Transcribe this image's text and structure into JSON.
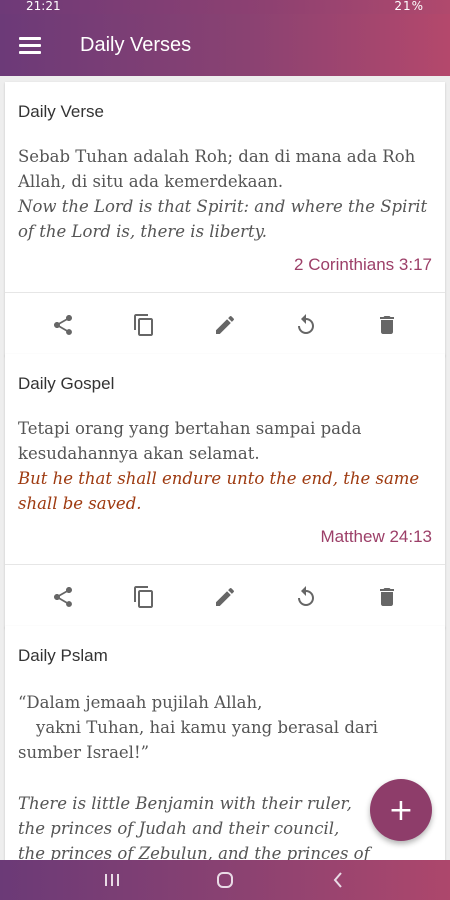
{
  "status": {
    "time": "21:21",
    "right": "21%"
  },
  "app_bar": {
    "title": "Daily Verses"
  },
  "cards": [
    {
      "title": "Daily Verse",
      "text_id": "Sebab Tuhan adalah Roh; dan di mana ada Roh Allah, di situ ada kemerdekaan.",
      "text_en": "Now the Lord is that Spirit: and where the Spirit of the Lord is, there is liberty.",
      "reference": "2 Corinthians 3:17"
    },
    {
      "title": "Daily Gospel",
      "text_id": "Tetapi orang yang bertahan sampai pada kesudahannya akan selamat.",
      "text_en": "But he that shall endure unto the end, the same shall be saved.",
      "reference": "Matthew 24:13"
    },
    {
      "title": "Daily Pslam",
      "text_id_line1": "“Dalam jemaah pujilah Allah,",
      "text_id_line2": "yakni Tuhan, hai kamu yang berasal dari",
      "text_id_line3": "sumber Israel!”",
      "text_en_line1": "There is little Benjamin with their ruler,",
      "text_en_line2": "the princes of Judah and their council,",
      "text_en_line3": "the princes of Zebulun, and the princes of"
    }
  ],
  "actions": [
    "share-icon",
    "copy-icon",
    "edit-icon",
    "refresh-icon",
    "delete-icon"
  ],
  "fab": {
    "label": "+"
  },
  "colors": {
    "accent": "#9c3f68",
    "gospel_red": "#9e3a10",
    "fab": "#8e3d6a"
  }
}
